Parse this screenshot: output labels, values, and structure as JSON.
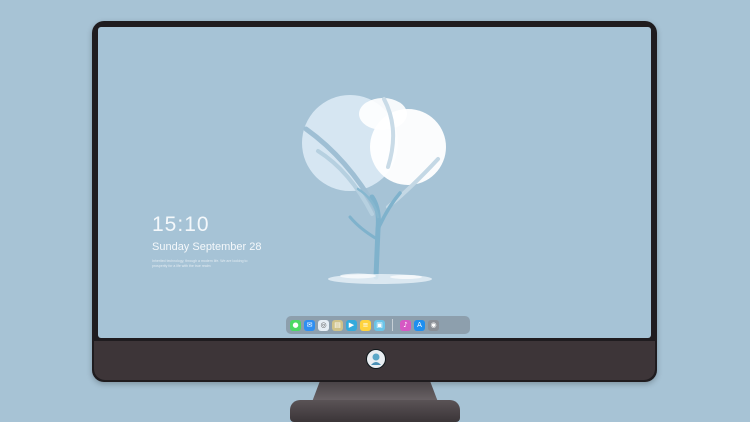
{
  "lockscreen": {
    "time": "15:10",
    "date": "Sunday September 28",
    "blurb": "Inherited technology, through a modern life. We are looking to prosperity for a life with the true realm"
  },
  "dock": {
    "items": [
      {
        "name": "messages-icon",
        "color": "#4cd964",
        "glyph": "●"
      },
      {
        "name": "mail-icon",
        "color": "#2f8ff2",
        "glyph": "✉"
      },
      {
        "name": "safari-icon",
        "color": "#e6eef5",
        "glyph": "◎"
      },
      {
        "name": "preview-icon",
        "color": "#d0c38a",
        "glyph": "▤"
      },
      {
        "name": "movie-icon",
        "color": "#34aadc",
        "glyph": "▶"
      },
      {
        "name": "notes-icon",
        "color": "#ffd33d",
        "glyph": "≡"
      },
      {
        "name": "photos-icon",
        "color": "#6bc4e8",
        "glyph": "▣"
      },
      {
        "name": "itunes-icon",
        "color": "#d658c4",
        "glyph": "♪"
      },
      {
        "name": "appstore-icon",
        "color": "#1f8ff0",
        "glyph": "A"
      },
      {
        "name": "camera-icon",
        "color": "#8a8f96",
        "glyph": "◉"
      }
    ]
  },
  "colors": {
    "wallpaper": "#a6c3d6",
    "bezel": "#1f1c1f",
    "chin": "#3d3538"
  }
}
